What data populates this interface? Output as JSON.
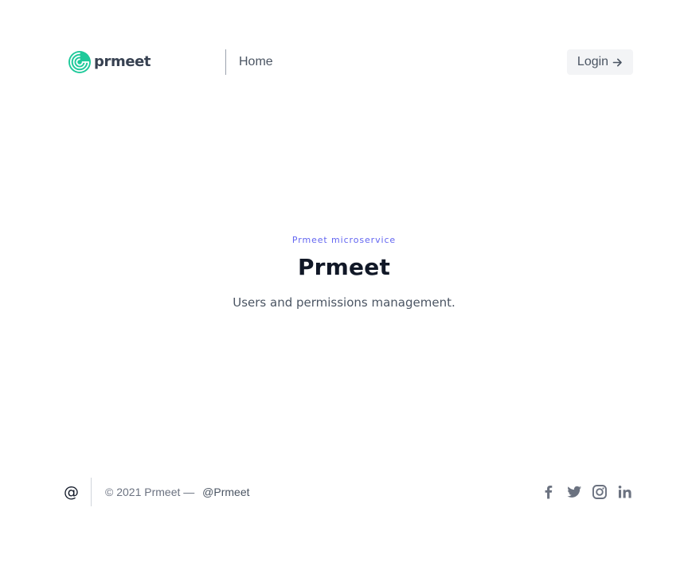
{
  "header": {
    "brand": "prmeet",
    "brand_icon": "prmeet-spiral-logo-icon",
    "nav": [
      {
        "label": "Home"
      }
    ],
    "login_label": "Login",
    "login_icon": "arrow-right-icon"
  },
  "hero": {
    "eyebrow": "Prmeet microservice",
    "title": "Prmeet",
    "subtitle": "Users and permissions management."
  },
  "footer": {
    "logo_symbol": "@",
    "copyright": "© 2021 Prmeet —",
    "handle": "@Prmeet",
    "social_icons": [
      "facebook-icon",
      "twitter-icon",
      "instagram-icon",
      "linkedin-icon"
    ]
  },
  "colors": {
    "brand_green": "#1ec99a",
    "accent": "#6366f1",
    "text_dark": "#111827",
    "text_muted": "#6b7280",
    "button_bg": "#f3f4f6"
  }
}
